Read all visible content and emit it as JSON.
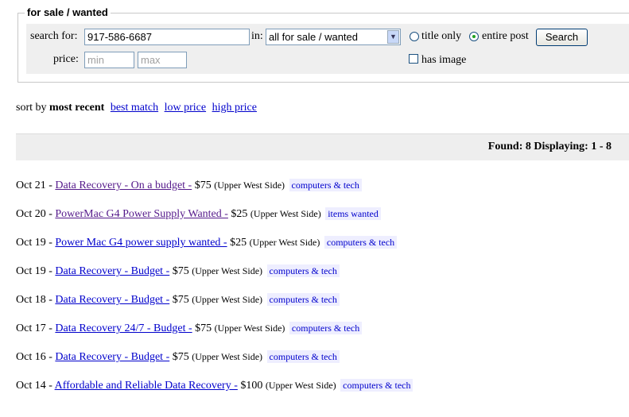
{
  "search": {
    "legend": "for sale / wanted",
    "search_for_label": "search for:",
    "query_value": "917-586-6687",
    "in_label": "in:",
    "category_selected": "all for sale / wanted",
    "title_only_label": "title only",
    "entire_post_label": "entire post",
    "search_button": "Search",
    "price_label": "price:",
    "min_placeholder": "min",
    "max_placeholder": "max",
    "has_image_label": "has image"
  },
  "sort": {
    "prefix": "sort by",
    "current": "most recent",
    "options": [
      "best match",
      "low price",
      "high price"
    ]
  },
  "results_bar": "Found: 8 Displaying: 1 - 8",
  "listings": [
    {
      "date": "Oct 21",
      "title": "Data Recovery - On a budget -",
      "price": "$75",
      "location": "(Upper West Side)",
      "category": "computers & tech",
      "visited": true
    },
    {
      "date": "Oct 20",
      "title": "PowerMac G4 Power Supply Wanted -",
      "price": "$25",
      "location": "(Upper West Side)",
      "category": "items wanted",
      "visited": true
    },
    {
      "date": "Oct 19",
      "title": "Power Mac G4 power supply wanted -",
      "price": "$25",
      "location": "(Upper West Side)",
      "category": "computers & tech",
      "visited": false
    },
    {
      "date": "Oct 19",
      "title": "Data Recovery - Budget -",
      "price": "$75",
      "location": "(Upper West Side)",
      "category": "computers & tech",
      "visited": false
    },
    {
      "date": "Oct 18",
      "title": "Data Recovery - Budget -",
      "price": "$75",
      "location": "(Upper West Side)",
      "category": "computers & tech",
      "visited": false
    },
    {
      "date": "Oct 17",
      "title": "Data Recovery 24/7 - Budget -",
      "price": "$75",
      "location": "(Upper West Side)",
      "category": "computers & tech",
      "visited": false
    },
    {
      "date": "Oct 16",
      "title": "Data Recovery - Budget -",
      "price": "$75",
      "location": "(Upper West Side)",
      "category": "computers & tech",
      "visited": false
    },
    {
      "date": "Oct 14",
      "title": "Affordable and Reliable Data Recovery -",
      "price": "$100",
      "location": "(Upper West Side)",
      "category": "computers & tech",
      "visited": false
    }
  ]
}
